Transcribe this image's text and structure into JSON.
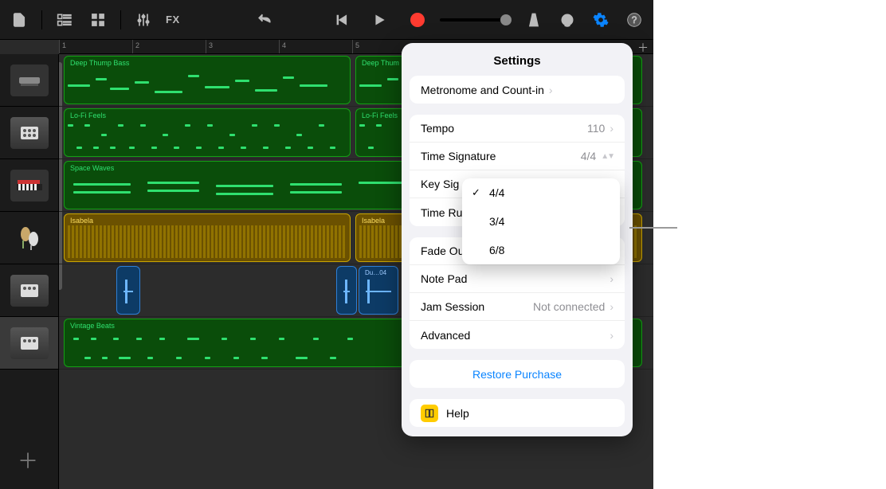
{
  "toolbar": {
    "fx_label": "FX"
  },
  "ruler": {
    "bars": [
      "1",
      "2",
      "3",
      "4",
      "5"
    ]
  },
  "track_icons": [
    "synth",
    "drum",
    "keys",
    "shaker",
    "drum",
    "drum"
  ],
  "regions": {
    "r0a_title": "Deep Thump Bass",
    "r0b_title": "Deep Thum",
    "r1a_title": "Lo-Fi Feels",
    "r1b_title": "Lo-Fi Feels",
    "r2_title": "Space Waves",
    "r3a_title": "Isabela",
    "r3b_title": "Isabela",
    "r4b_title": "Du…04",
    "r5_title": "Vintage Beats"
  },
  "settings": {
    "title": "Settings",
    "metronome": "Metronome and Count-in",
    "tempo_label": "Tempo",
    "tempo_value": "110",
    "timesig_label": "Time Signature",
    "timesig_value": "4/4",
    "keysig_label": "Key Sig",
    "timeruler_label": "Time Ru",
    "fadeout": "Fade Out",
    "notepad": "Note Pad",
    "jam_label": "Jam Session",
    "jam_value": "Not connected",
    "advanced": "Advanced",
    "restore": "Restore Purchase",
    "help": "Help"
  },
  "time_sig_options": [
    "4/4",
    "3/4",
    "6/8"
  ],
  "time_sig_selected": "4/4"
}
